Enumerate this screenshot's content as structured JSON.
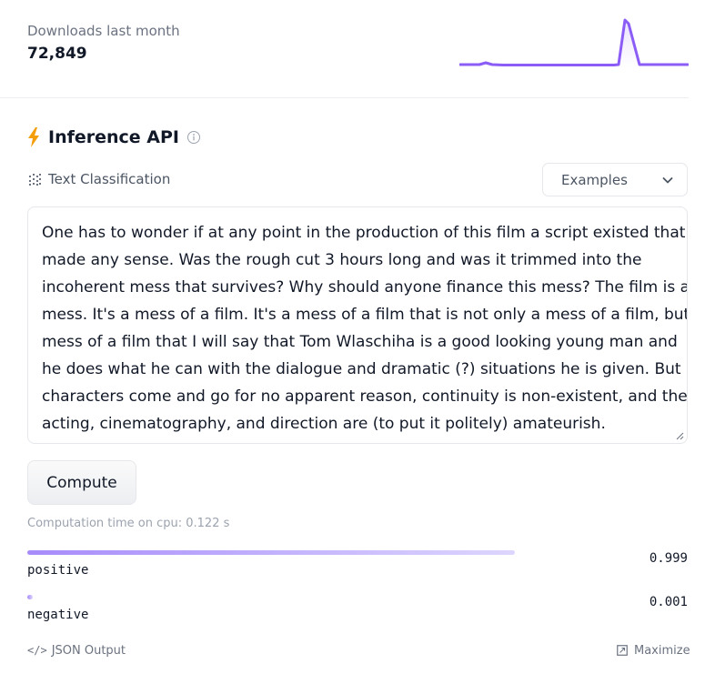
{
  "downloads": {
    "label": "Downloads last month",
    "count": "72,849"
  },
  "inference": {
    "title": "Inference API",
    "task_label": "Text Classification",
    "examples_label": "Examples",
    "input_text": "One has to wonder if at any point in the production of this film a script existed that\nmade any sense. Was the rough cut 3 hours long and was it trimmed into the\nincoherent mess that survives? Why should anyone finance this mess? The film is a\nmess. It's a mess of a film. It's a mess of a film that is not only a mess of a film, but s\nmess of a film that I will say that Tom Wlaschiha is a good looking young man and\nhe does what he can with the dialogue and dramatic (?) situations he is given. But\ncharacters come and go for no apparent reason, continuity is non-existent, and the\nacting, cinematography, and direction are (to put it politely) amateurish.",
    "compute_label": "Compute",
    "computation_time": "Computation time on cpu: 0.122 s",
    "results": [
      {
        "label": "positive",
        "score": "0.999",
        "fraction": 0.999
      },
      {
        "label": "negative",
        "score": "0.001",
        "fraction": 0.001
      }
    ],
    "json_output_label": "JSON Output",
    "maximize_label": "Maximize"
  },
  "colors": {
    "accent": "#8b5cf6",
    "bar_start": "#a78bfa",
    "bar_end": "#ddd6fe",
    "bolt": "#f59e0b"
  },
  "icons": [
    "lightning-icon",
    "info-icon",
    "text-classification-icon",
    "chevron-down-icon",
    "code-icon",
    "maximize-icon"
  ]
}
